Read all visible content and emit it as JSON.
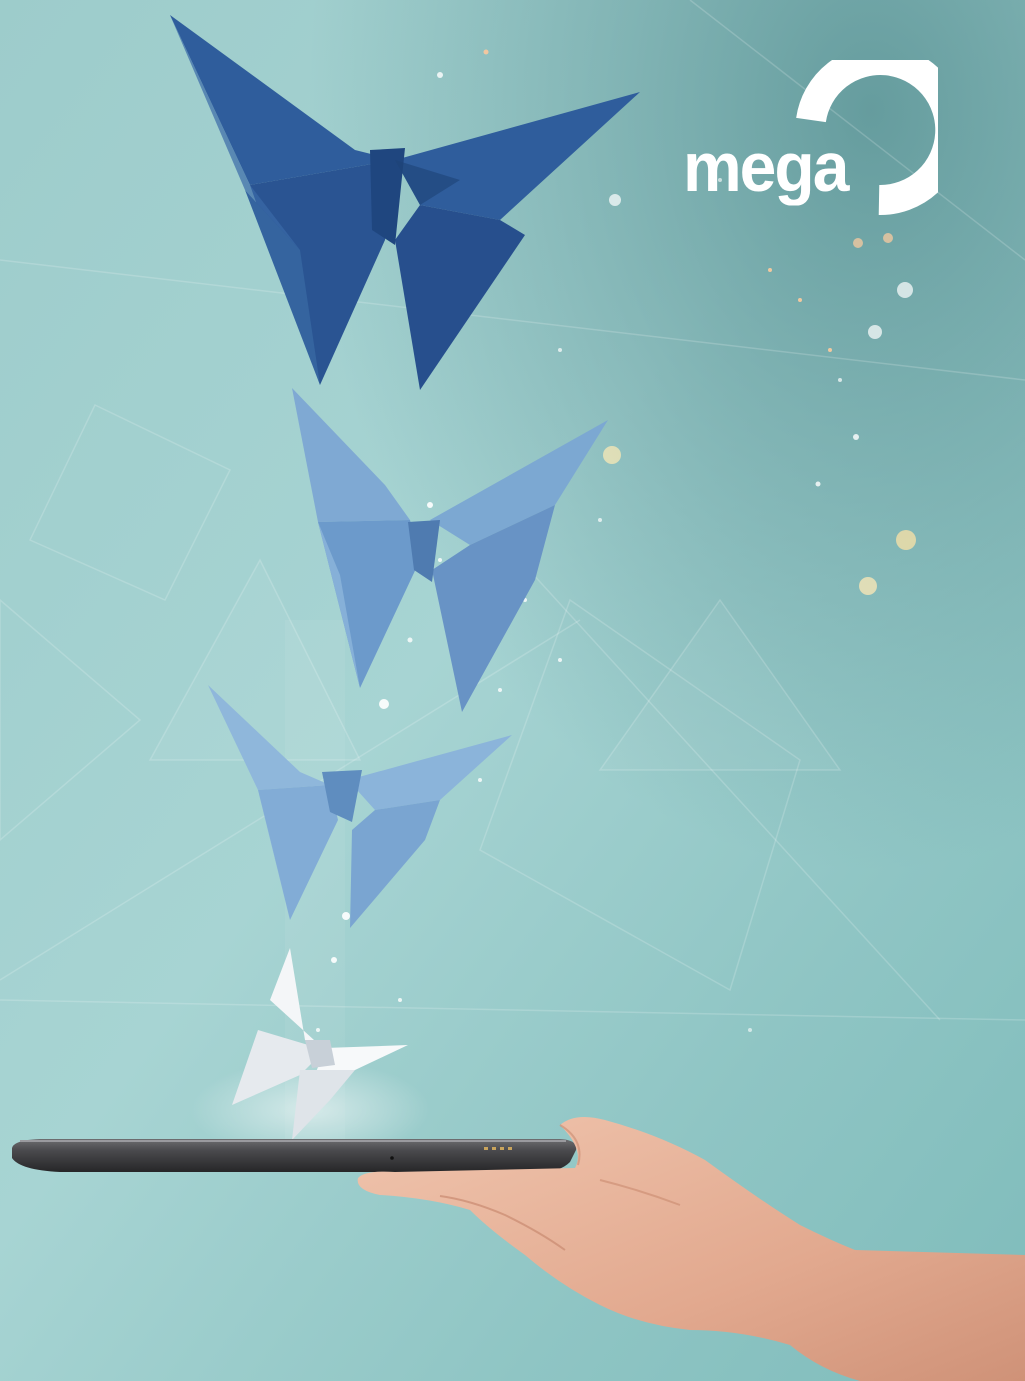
{
  "brand": {
    "logo_text": "mega",
    "logo_icon": "ring-arc-icon",
    "logo_color": "#ffffff"
  },
  "colors": {
    "background_top": "#6fa7a9",
    "background_mid": "#9fcfcf",
    "background_bottom": "#86c1c0",
    "butterfly_dark": "#2f5c9a",
    "butterfly_medium": "#6f9fcf",
    "butterfly_light": "#8db5d9",
    "butterfly_white": "#f2f4f6",
    "tablet": "#3b3b3d",
    "skin": "#e8b49a"
  },
  "image": {
    "butterflies": [
      "dark-blue-origami-butterfly",
      "blue-origami-butterfly",
      "light-blue-origami-butterfly",
      "white-origami-butterfly"
    ],
    "device": "tablet",
    "hand": "open-hand"
  }
}
